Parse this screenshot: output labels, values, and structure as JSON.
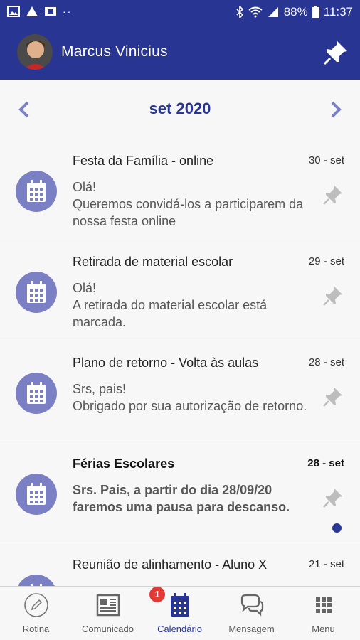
{
  "status_bar": {
    "battery": "88%",
    "time": "11:37",
    "left_icons": [
      "image-icon",
      "alert-icon",
      "card-icon",
      "more-dots-icon"
    ],
    "right_icons": [
      "bluetooth-icon",
      "wifi-icon",
      "signal-icon",
      "battery-icon"
    ]
  },
  "header": {
    "user_name": "Marcus Vinicius",
    "pin_icon": "pin-icon",
    "color": "#283593"
  },
  "month_nav": {
    "label": "set 2020"
  },
  "events": [
    {
      "title": "Festa da Família - online",
      "date": "30 - set",
      "line1": "Olá!",
      "line2": "Queremos convidá-los a participarem da nossa festa online",
      "unread": false
    },
    {
      "title": "Retirada de material escolar",
      "date": "29 - set",
      "line1": "Olá!",
      "line2": "A retirada do material escolar está marcada.",
      "unread": false
    },
    {
      "title": "Plano de retorno - Volta às aulas",
      "date": "28 - set",
      "line1": "Srs, pais!",
      "line2": "Obrigado por sua autorização de retorno.",
      "unread": false
    },
    {
      "title": "Férias Escolares",
      "date": "28 - set",
      "line1": "Srs. Pais, a partir do dia 28/09/20 faremos uma pausa para descanso.",
      "line2": "",
      "unread": true
    },
    {
      "title": "Reunião de alinhamento - Aluno X",
      "date": "21 - set",
      "line1": "",
      "line2": "",
      "unread": false
    }
  ],
  "bottom_nav": {
    "items": [
      {
        "label": "Rotina",
        "icon": "pencil-circle-icon"
      },
      {
        "label": "Comunicado",
        "icon": "newspaper-icon"
      },
      {
        "label": "Calendário",
        "icon": "calendar-icon",
        "badge": "1",
        "active": true
      },
      {
        "label": "Mensagem",
        "icon": "chat-bubbles-icon"
      },
      {
        "label": "Menu",
        "icon": "grid-menu-icon"
      }
    ]
  },
  "colors": {
    "primary": "#283593",
    "event_icon_bg": "#7b7fc4",
    "badge": "#e53935"
  }
}
